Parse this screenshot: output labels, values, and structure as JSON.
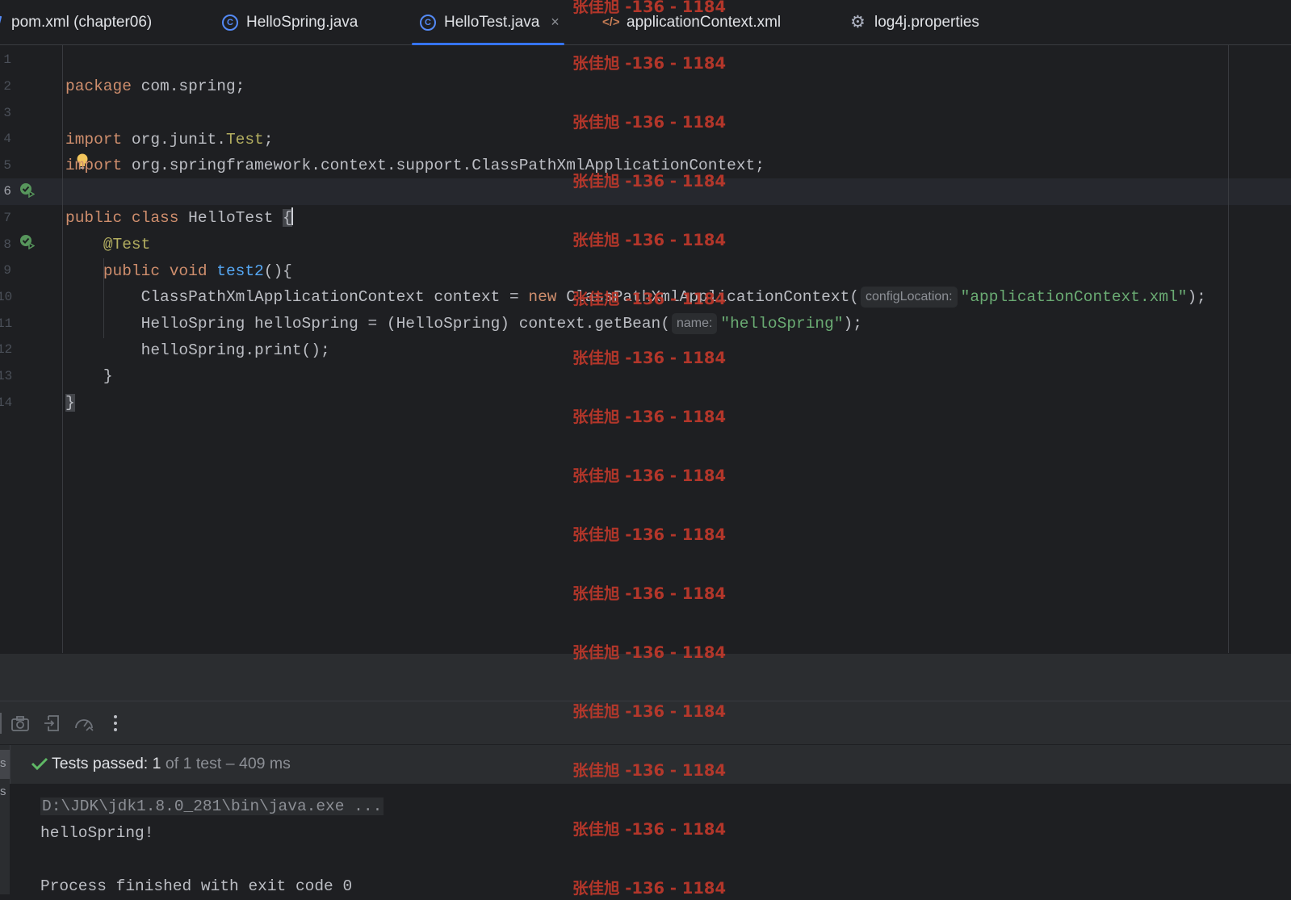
{
  "tabs": [
    {
      "label": "pom.xml (chapter06)",
      "icon": "maven-icon"
    },
    {
      "label": "HelloSpring.java",
      "icon": "class-icon"
    },
    {
      "label": "HelloTest.java",
      "icon": "class-icon",
      "active": true,
      "close": "×"
    },
    {
      "label": "applicationContext.xml",
      "icon": "xml-icon"
    },
    {
      "label": "log4j.properties",
      "icon": "gear-icon"
    }
  ],
  "editor": {
    "line_numbers": [
      "1",
      "2",
      "3",
      "4",
      "5",
      "6",
      "7",
      "8",
      "9",
      "10",
      "11",
      "12",
      "13",
      "14"
    ],
    "code": {
      "l1": {
        "kw": "package",
        "rest": " com.spring;"
      },
      "l3": {
        "kw": "import",
        "rest": " org.junit.",
        "cls": "Test",
        "end": ";"
      },
      "l4": {
        "kw": "import",
        "rest": " org.springframework.context.support.ClassPathXmlApplicationContext;"
      },
      "l6": {
        "kw1": "public",
        "kw2": "class",
        "name": " HelloTest ",
        "brace": "{"
      },
      "l7": {
        "ann": "@Test"
      },
      "l8": {
        "kw1": "public",
        "kw2": "void",
        "fn": "test2",
        "end": "(){"
      },
      "l9": {
        "a": "ClassPathXmlApplicationContext context = ",
        "kw": "new",
        "b": " ClassPathXmlApplicationContext(",
        "hint": "configLocation:",
        "str": "\"applicationContext.xml\"",
        "end": ");"
      },
      "l10": {
        "a": "HelloSpring helloSpring = (HelloSpring) context.getBean(",
        "hint": "name:",
        "str": "\"helloSpring\"",
        "end": ");"
      },
      "l11": {
        "a": "helloSpring.print();"
      },
      "l12": {
        "a": "}"
      },
      "l13": {
        "a": "}"
      }
    }
  },
  "run": {
    "status_main": "Tests passed: 1",
    "status_dim": " of 1 test – 409 ms",
    "strip_letters": [
      "s",
      "s"
    ],
    "console": {
      "cmd": "D:\\JDK\\jdk1.8.0_281\\bin\\java.exe ...",
      "out": "helloSpring!",
      "exit": "Process finished with exit code 0"
    }
  },
  "watermark": {
    "text": "张佳旭 -136 - 1184"
  }
}
